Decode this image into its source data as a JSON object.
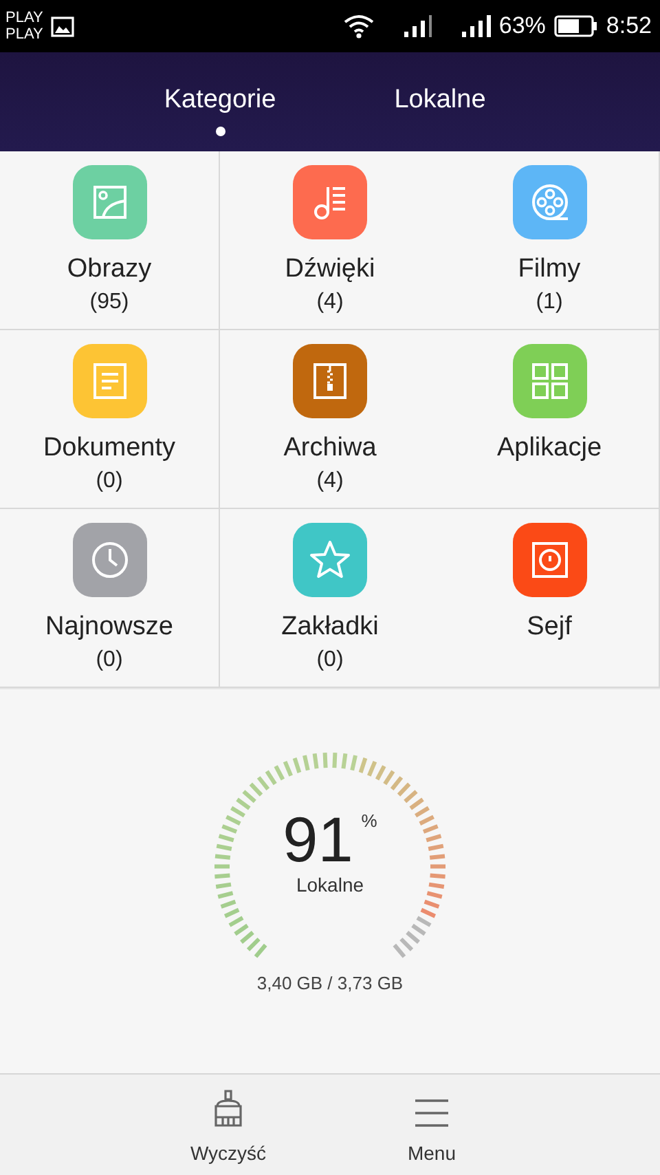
{
  "status_bar": {
    "carrier_lines": [
      "PLAY",
      "PLAY"
    ],
    "battery_percent": "63%",
    "time": "8:52"
  },
  "tabs": [
    {
      "label": "Kategorie",
      "selected": true
    },
    {
      "label": "Lokalne",
      "selected": false
    }
  ],
  "categories": [
    {
      "kind": "images",
      "color": "#6dd0a2",
      "label": "Obrazy",
      "count": "(95)"
    },
    {
      "kind": "music",
      "color": "#fd6b4f",
      "label": "Dźwięki",
      "count": "(4)"
    },
    {
      "kind": "video",
      "color": "#5db6f6",
      "label": "Filmy",
      "count": "(1)"
    },
    {
      "kind": "document",
      "color": "#fdc434",
      "label": "Dokumenty",
      "count": "(0)"
    },
    {
      "kind": "archive",
      "color": "#c0680e",
      "label": "Archiwa",
      "count": "(4)"
    },
    {
      "kind": "apps",
      "color": "#7fcf56",
      "label": "Aplikacje"
    },
    {
      "kind": "recent",
      "color": "#a2a3a8",
      "label": "Najnowsze",
      "count": "(0)"
    },
    {
      "kind": "bookmark",
      "color": "#40c6c6",
      "label": "Zakładki",
      "count": "(0)"
    },
    {
      "kind": "safe",
      "color": "#fb4a16",
      "label": "Sejf"
    }
  ],
  "storage": {
    "value": "91",
    "unit": "%",
    "label": "Lokalne",
    "usage": "3,40 GB / 3,73 GB"
  },
  "bottom_bar": [
    {
      "kind": "clean",
      "label": "Wyczyść"
    },
    {
      "kind": "menu",
      "label": "Menu"
    }
  ]
}
